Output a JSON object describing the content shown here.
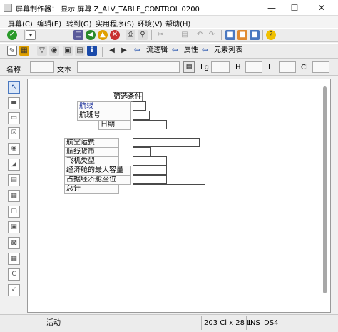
{
  "window": {
    "title": "屏幕制作器： 显示 屏幕 Z_ALV_TABLE_CONTROL 0200"
  },
  "menu": [
    {
      "label": "屏幕(C)"
    },
    {
      "label": "编辑(E)"
    },
    {
      "label": "转到(G)"
    },
    {
      "label": "实用程序(S)"
    },
    {
      "label": "环境(V)"
    },
    {
      "label": "帮助(H)"
    }
  ],
  "toolbar2": {
    "flow_logic": "流逻辑",
    "attributes": "属性",
    "element_list": "元素列表"
  },
  "fieldbar": {
    "name_label": "名称",
    "text_label": "文本",
    "lg_label": "Lg",
    "h_label": "H",
    "l_label": "L",
    "cl_label": "Cl"
  },
  "screen": {
    "frame_title": "筛选条件",
    "labels": [
      "航线",
      "航班号",
      "日期",
      "航空运费",
      "航线货币",
      "飞机类型",
      "经济舱的最大容量",
      "占据经济舱座位",
      "总计"
    ]
  },
  "status": {
    "mode": "活动",
    "position": "203 Cl x 28 L",
    "ins": "INS",
    "system": "DS4"
  },
  "colors": {
    "accent": "#1a2f9a",
    "arrow_blue": "#1a4aaa",
    "check_green": "#2a9a2a"
  },
  "icons": [
    "check-icon",
    "save-icon",
    "back-icon",
    "exit-icon",
    "cancel-icon",
    "print-icon",
    "find-icon",
    "cut-icon",
    "copy-icon",
    "paste-icon",
    "undo-icon",
    "redo-icon",
    "layout-icon",
    "help-icon",
    "pointer-icon",
    "info-icon"
  ]
}
